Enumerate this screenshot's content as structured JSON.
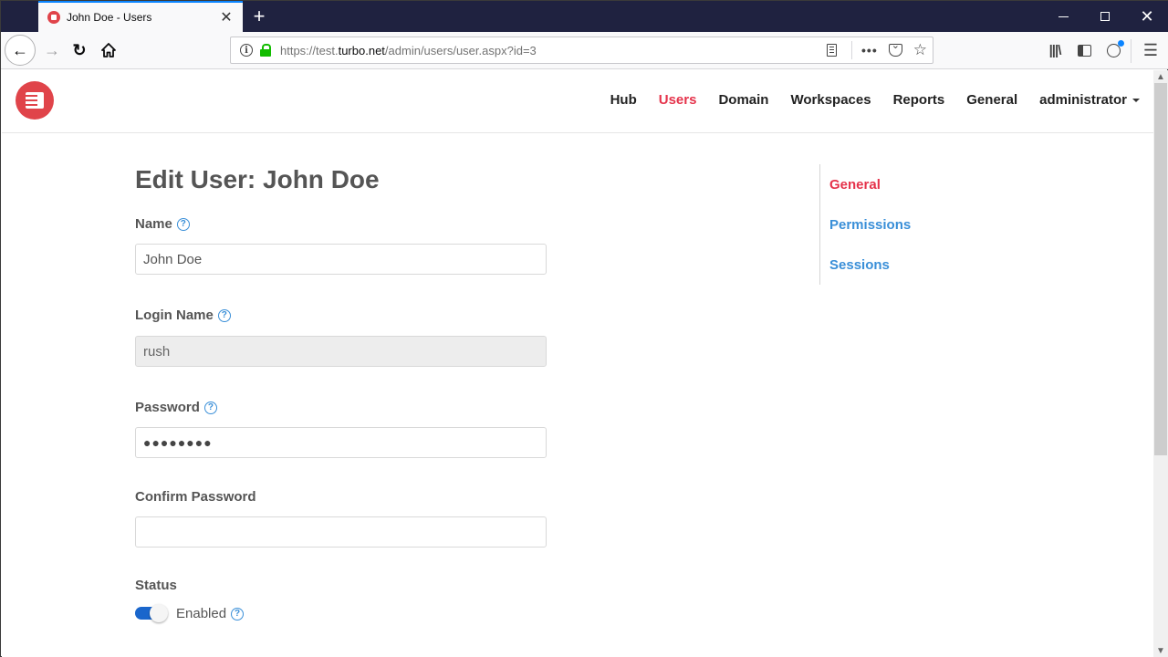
{
  "browser": {
    "tab_title": "John Doe - Users",
    "url_prefix": "https://test.",
    "url_domain": "turbo.net",
    "url_path": "/admin/users/user.aspx?id=3",
    "icons": {
      "back": "arrow-left-icon",
      "forward": "arrow-right-icon",
      "reload": "reload-icon",
      "home": "home-icon",
      "info": "info-icon",
      "lock": "lock-icon",
      "reader": "reader-view-icon",
      "more": "more-icon",
      "pocket": "pocket-icon",
      "bookmark": "star-icon",
      "library": "library-icon",
      "sidebar": "sidebar-icon",
      "account": "account-icon",
      "menu": "hamburger-menu-icon"
    },
    "glyphs": {
      "close": "✕",
      "new_tab": "+",
      "back": "←",
      "forward": "→",
      "reload": "↻",
      "info": "i",
      "more": "•••",
      "star": "☆",
      "library": "|||\\",
      "menu": "☰",
      "win_close": "✕",
      "scroll_up": "▲",
      "scroll_down": "▼"
    }
  },
  "header": {
    "nav": [
      {
        "label": "Hub",
        "active": false
      },
      {
        "label": "Users",
        "active": true
      },
      {
        "label": "Domain",
        "active": false
      },
      {
        "label": "Workspaces",
        "active": false
      },
      {
        "label": "Reports",
        "active": false
      },
      {
        "label": "General",
        "active": false
      }
    ],
    "user_menu": "administrator"
  },
  "main": {
    "title": "Edit User: John Doe",
    "help_glyph": "?",
    "fields": {
      "name": {
        "label": "Name",
        "value": "John Doe"
      },
      "login_name": {
        "label": "Login Name",
        "value": "rush",
        "disabled": true
      },
      "password": {
        "label": "Password",
        "value": "●●●●●●●●"
      },
      "confirm_password": {
        "label": "Confirm Password",
        "value": ""
      },
      "status": {
        "label": "Status",
        "toggle_label": "Enabled",
        "enabled": true
      }
    }
  },
  "sidenav": {
    "items": [
      {
        "label": "General",
        "active": true
      },
      {
        "label": "Permissions",
        "active": false
      },
      {
        "label": "Sessions",
        "active": false
      }
    ]
  },
  "colors": {
    "accent_red": "#e5334b",
    "link_blue": "#3a8fd8",
    "toggle_blue": "#1a66cc",
    "logo_red": "#e0444a",
    "titlebar": "#1f2240"
  }
}
